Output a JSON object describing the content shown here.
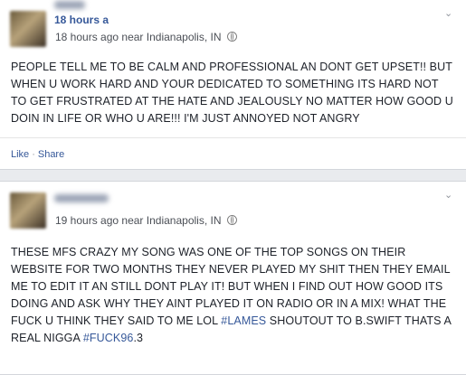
{
  "posts": [
    {
      "time_partial": "18 hours a",
      "time": "18 hours ago",
      "near": "near",
      "location": "Indianapolis, IN",
      "text": "PEOPLE TELL ME TO BE CALM AND PROFESSIONAL AN DONT GET UPSET!! BUT WHEN U WORK HARD AND YOUR DEDICATED TO SOMETHING ITS HARD NOT TO GET FRUSTRATED AT THE HATE AND JEALOUSLY NO MATTER HOW GOOD U DOIN IN LIFE OR WHO U ARE!!! I'M JUST ANNOYED NOT ANGRY",
      "like_label": "Like",
      "share_label": "Share",
      "sep": "·"
    },
    {
      "time": "19 hours ago",
      "near": "near",
      "location": "Indianapolis, IN",
      "text_before": "THESE MFS CRAZY MY SONG WAS ONE OF THE TOP SONGS ON THEIR WEBSITE FOR TWO MONTHS THEY NEVER PLAYED MY SHIT THEN THEY EMAIL ME TO EDIT IT AN STILL DONT PLAY IT! BUT WHEN I FIND OUT HOW GOOD ITS DOING AND ASK WHY THEY AINT PLAYED IT ON RADIO OR IN A MIX! WHAT THE FUCK U THINK THEY SAID TO ME LOL ",
      "hashtag1": "#LAMES",
      "text_middle": " SHOUTOUT TO B.SWIFT THATS A REAL NIGGA ",
      "hashtag2": "#FUCK96",
      "text_after": ".3"
    }
  ],
  "icons": {
    "privacy": "globe-icon",
    "menu": "chevron-down-icon"
  }
}
